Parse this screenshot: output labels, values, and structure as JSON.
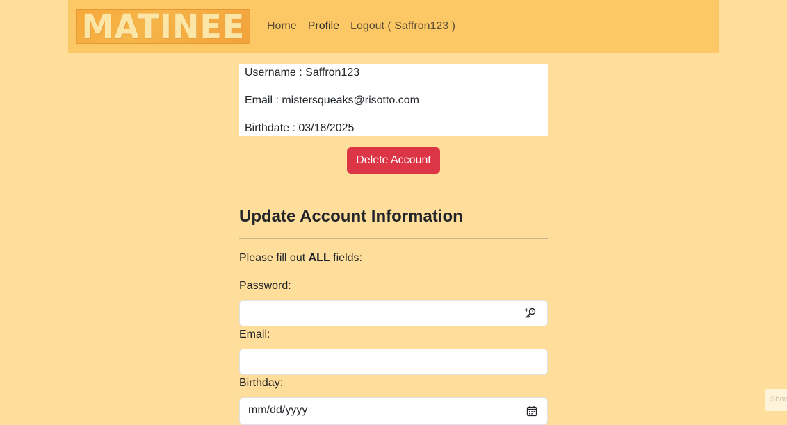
{
  "nav": {
    "logo_text": "MATINEE",
    "home": "Home",
    "profile": "Profile",
    "logout": "Logout ( Saffron123 )"
  },
  "profile": {
    "username": "Username : Saffron123",
    "email": "Email : mistersqueaks@risotto.com",
    "birthdate": "Birthdate : 03/18/2025"
  },
  "delete_button": "Delete Account",
  "update": {
    "title": "Update Account Information",
    "instructions_prefix": "Please fill out ",
    "instructions_bold": "ALL",
    "instructions_suffix": " fields:",
    "password_label": "Password:",
    "email_label": "Email:",
    "birthday_label": "Birthday:",
    "birthday_placeholder": "mm/dd/yyyy"
  },
  "side_tab": "Show",
  "colors": {
    "page_bg": "#ffdd9b",
    "navbar_bg": "#fcc765",
    "danger": "#dc3545"
  },
  "icons": {
    "password_field": "key-plus-icon",
    "birthday_field": "calendar-icon"
  }
}
